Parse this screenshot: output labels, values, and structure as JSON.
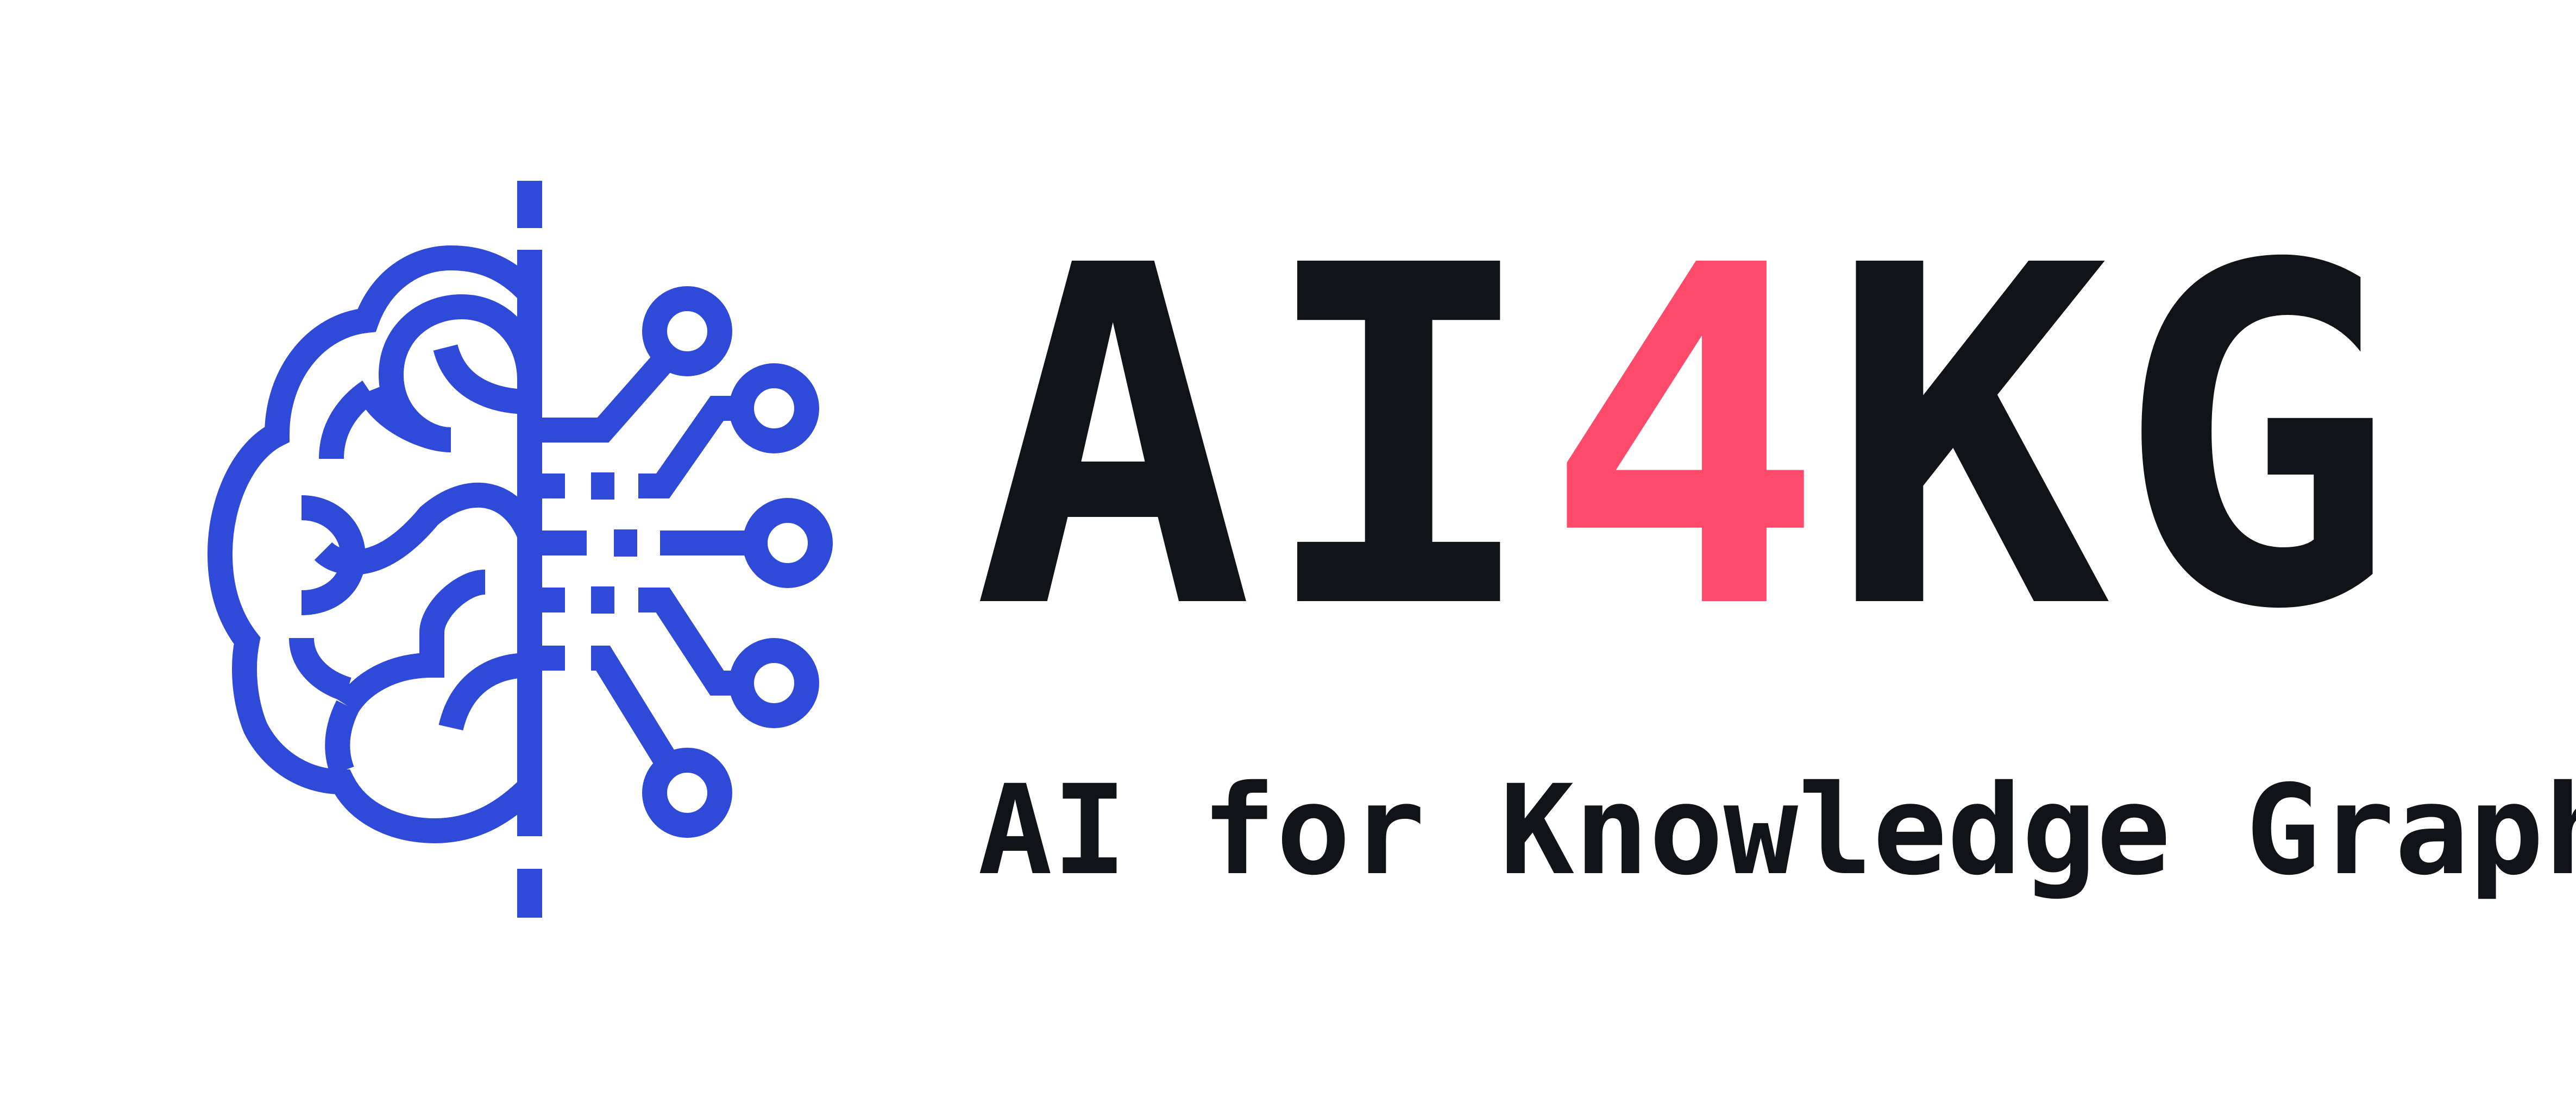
{
  "logo": {
    "title_letters": [
      {
        "char": "A",
        "color": "#101418"
      },
      {
        "char": "I",
        "color": "#101418"
      },
      {
        "char": "4",
        "color": "#ff4a6b"
      },
      {
        "char": "K",
        "color": "#101418"
      },
      {
        "char": "G",
        "color": "#101418"
      }
    ],
    "tagline": "AI for Knowledge Graph",
    "icon": "brain-circuit-icon",
    "colors": {
      "brain_blue": "#2f4ad8",
      "text_dark": "#101418",
      "accent_pink": "#ff4a6b",
      "background": "#ffffff"
    }
  }
}
